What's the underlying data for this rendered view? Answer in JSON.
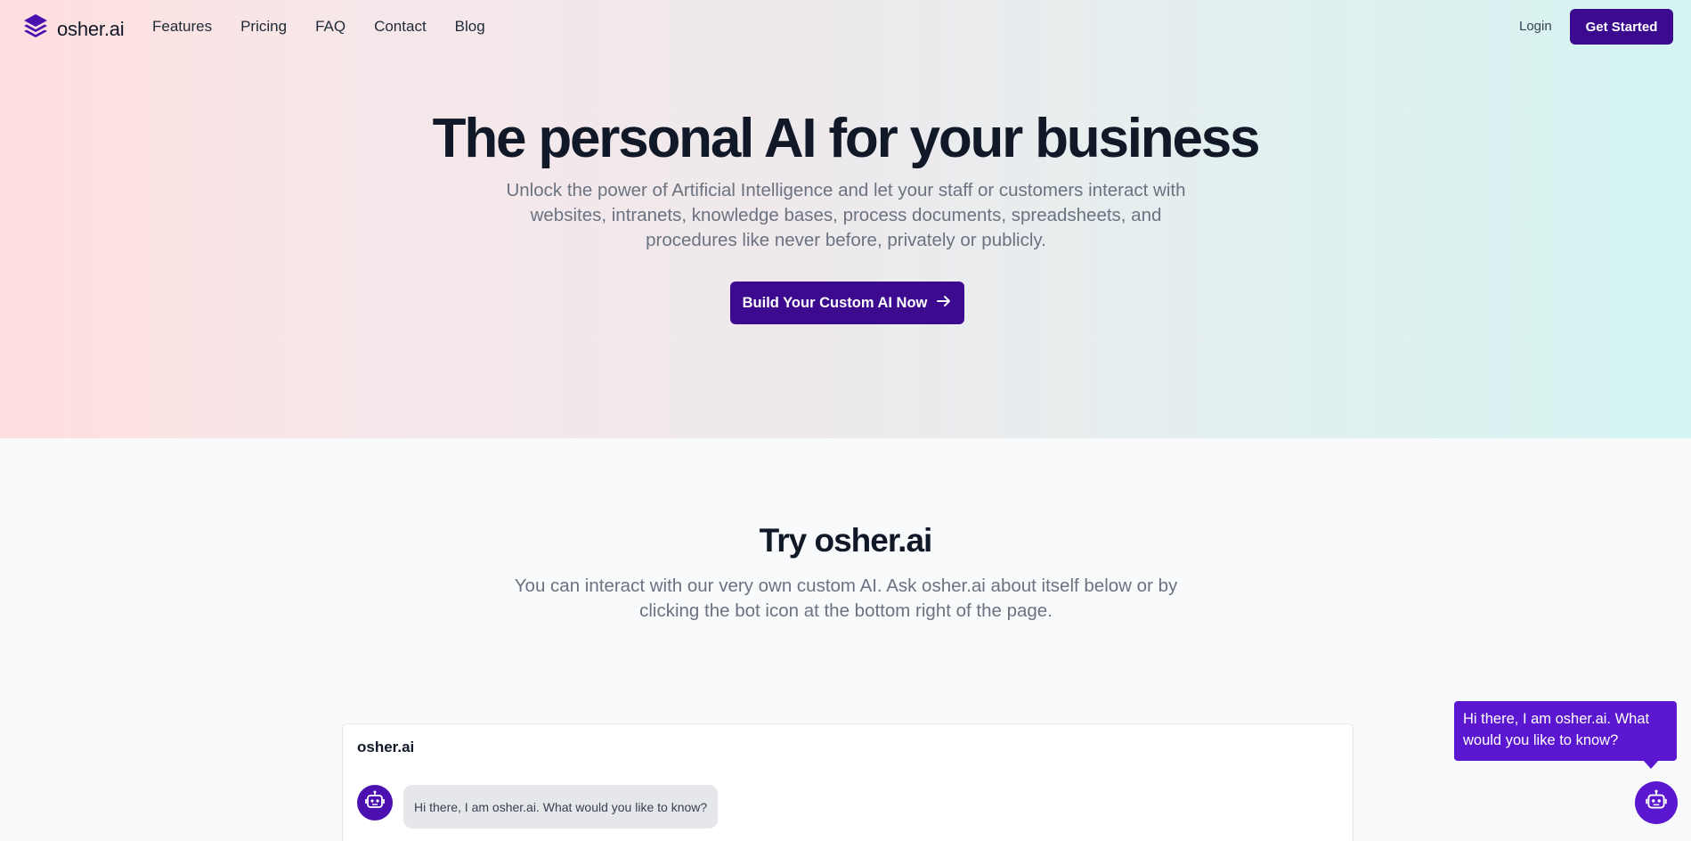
{
  "nav": {
    "brand": "osher.ai",
    "links": [
      "Features",
      "Pricing",
      "FAQ",
      "Contact",
      "Blog"
    ],
    "login": "Login",
    "cta": "Get Started"
  },
  "hero": {
    "title": "The personal AI for your business",
    "subtitle": "Unlock the power of Artificial Intelligence and let your staff or customers interact with websites, intranets, knowledge bases, process documents, spreadsheets, and procedures like never before, privately or publicly.",
    "cta": "Build Your Custom AI Now"
  },
  "try": {
    "title": "Try osher.ai",
    "subtitle": "You can interact with our very own custom AI. Ask osher.ai about itself below or by clicking the bot icon at the bottom right of the page."
  },
  "chat": {
    "title": "osher.ai",
    "message": "Hi there, I am osher.ai. What would you like to know?"
  },
  "widget": {
    "tooltip": "Hi there, I am osher.ai. What would you like to know?"
  },
  "colors": {
    "primary": "#3b0a8f",
    "bot": "#5b16d0",
    "text_muted": "#6b7280"
  },
  "icons": {
    "logo": "layers-icon",
    "cta_arrow": "arrow-right-icon",
    "bot": "robot-icon"
  }
}
